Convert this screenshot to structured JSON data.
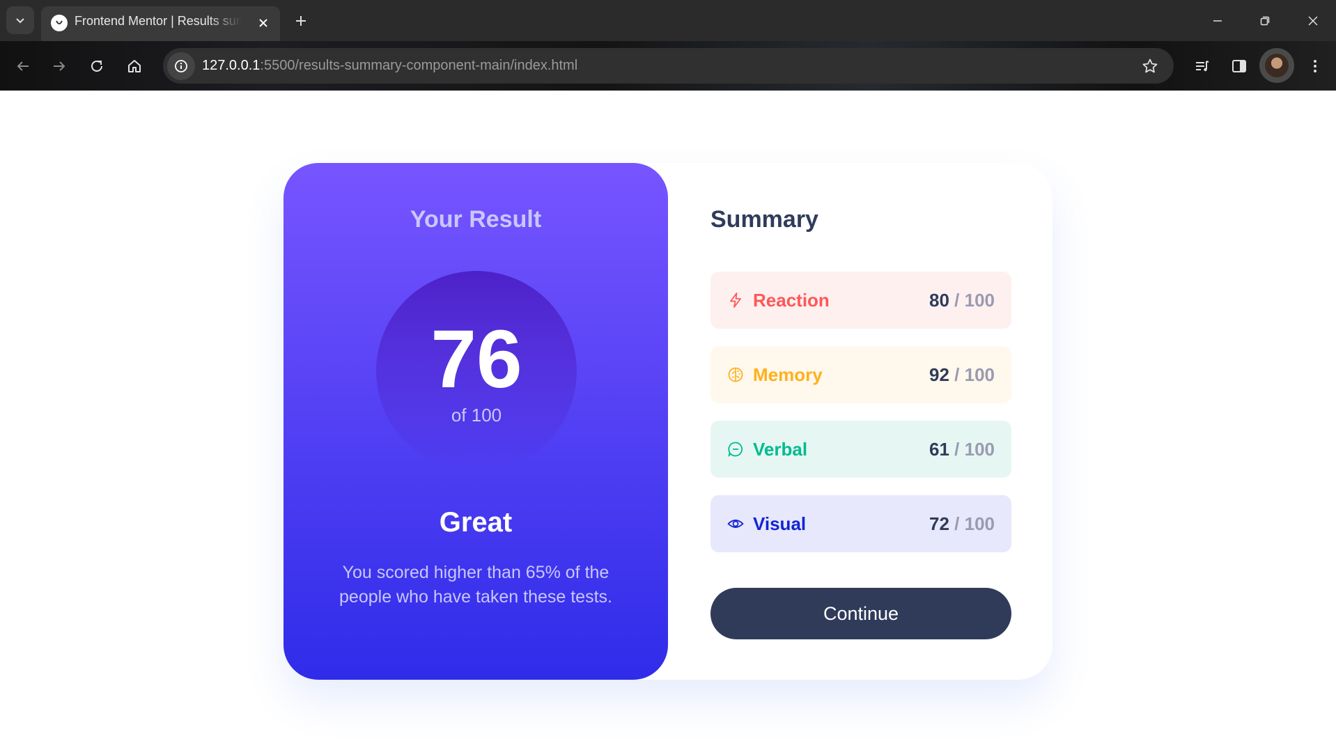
{
  "browser": {
    "tab": {
      "title": "Frontend Mentor | Results summary component"
    },
    "url": {
      "host": "127.0.0.1",
      "rest": ":5500/results-summary-component-main/index.html"
    }
  },
  "result": {
    "heading": "Your Result",
    "score": "76",
    "of": "of 100",
    "rating": "Great",
    "description": "You scored higher than 65% of the people who have taken these tests."
  },
  "summary": {
    "heading": "Summary",
    "items": [
      {
        "label": "Reaction",
        "score": "80",
        "max": "/ 100",
        "icon": "lightning-icon",
        "color": "#ff5757",
        "bg": "#fff0f0"
      },
      {
        "label": "Memory",
        "score": "92",
        "max": "/ 100",
        "icon": "brain-icon",
        "color": "#ffb01f",
        "bg": "#fff8ec"
      },
      {
        "label": "Verbal",
        "score": "61",
        "max": "/ 100",
        "icon": "chat-icon",
        "color": "#00bb8f",
        "bg": "#e6f7f3"
      },
      {
        "label": "Visual",
        "score": "72",
        "max": "/ 100",
        "icon": "eye-icon",
        "color": "#1125d4",
        "bg": "#e7e8fb"
      }
    ],
    "continue_label": "Continue"
  }
}
